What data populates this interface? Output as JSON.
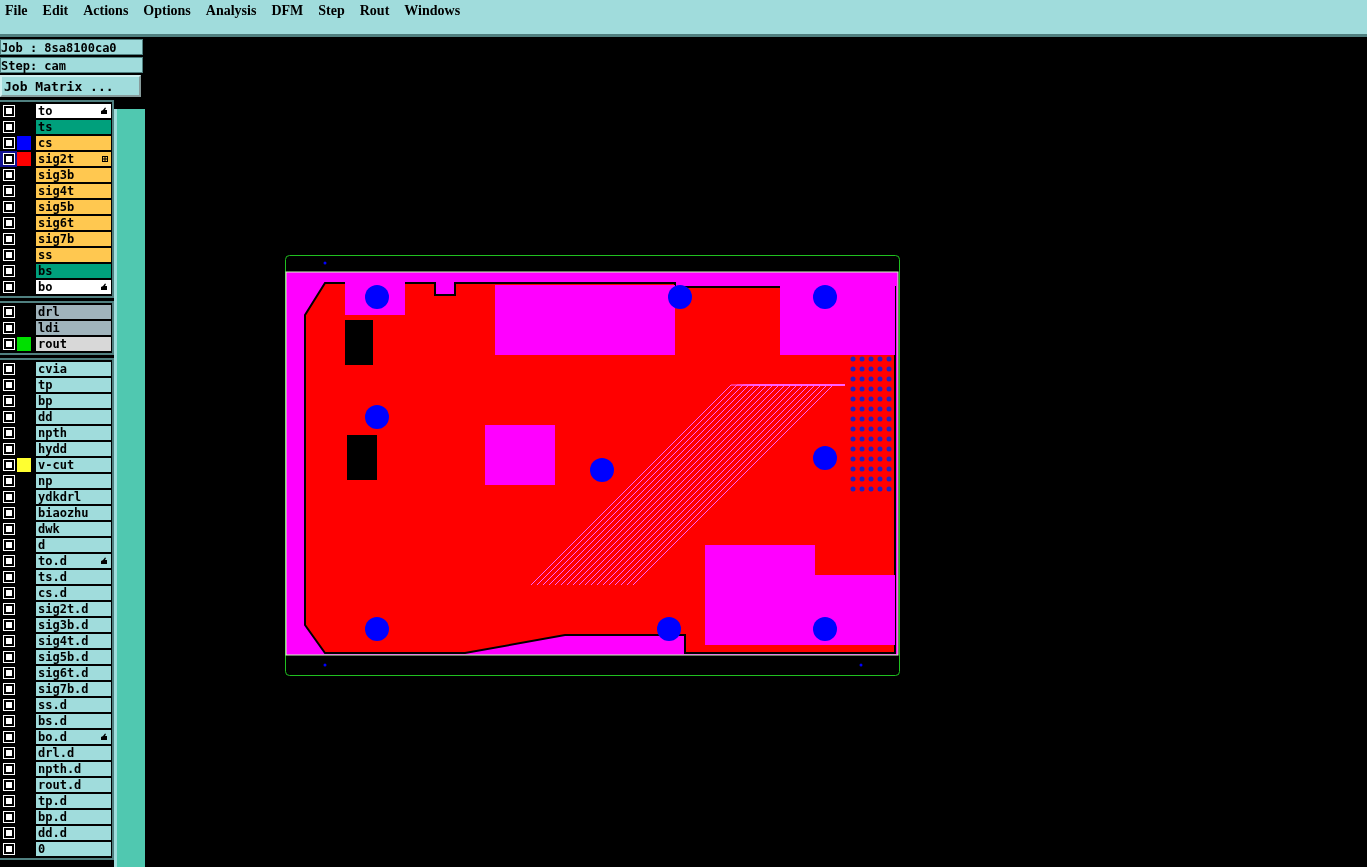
{
  "menu": [
    "File",
    "Edit",
    "Actions",
    "Options",
    "Analysis",
    "DFM",
    "Step",
    "Rout",
    "Windows"
  ],
  "job": {
    "job_line": "Job : 8sa8100ca0",
    "step_line": "Step: cam",
    "matrix_button": "Job Matrix ..."
  },
  "layer_groups": [
    [
      {
        "name": "to",
        "kind": "board",
        "selected": false,
        "affected": true,
        "attached": false
      },
      {
        "name": "ts",
        "kind": "solder",
        "selected": false,
        "affected": false,
        "attached": false
      },
      {
        "name": "cs",
        "kind": "signal",
        "selected": false,
        "affected": false,
        "attached": false,
        "color": "#0000ff"
      },
      {
        "name": "sig2t",
        "kind": "signal",
        "selected": true,
        "affected": false,
        "attached": true,
        "color": "#ff0000"
      },
      {
        "name": "sig3b",
        "kind": "signal",
        "selected": false,
        "affected": false,
        "attached": false
      },
      {
        "name": "sig4t",
        "kind": "signal",
        "selected": false,
        "affected": false,
        "attached": false
      },
      {
        "name": "sig5b",
        "kind": "signal",
        "selected": false,
        "affected": false,
        "attached": false
      },
      {
        "name": "sig6t",
        "kind": "signal",
        "selected": false,
        "affected": false,
        "attached": false
      },
      {
        "name": "sig7b",
        "kind": "signal",
        "selected": false,
        "affected": false,
        "attached": false
      },
      {
        "name": "ss",
        "kind": "signal",
        "selected": false,
        "affected": false,
        "attached": false
      },
      {
        "name": "bs",
        "kind": "solder",
        "selected": false,
        "affected": false,
        "attached": false
      },
      {
        "name": "bo",
        "kind": "board",
        "selected": false,
        "affected": true,
        "attached": false
      }
    ],
    [
      {
        "name": "drl",
        "kind": "drill",
        "selected": false,
        "affected": false,
        "attached": false
      },
      {
        "name": "ldi",
        "kind": "drill",
        "selected": false,
        "affected": false,
        "attached": false
      },
      {
        "name": "rout",
        "kind": "rout",
        "selected": false,
        "affected": false,
        "attached": false,
        "color": "#00e000"
      }
    ],
    [
      {
        "name": "cvia",
        "kind": "misc",
        "selected": false,
        "affected": false,
        "attached": false
      },
      {
        "name": "tp",
        "kind": "misc",
        "selected": false,
        "affected": false,
        "attached": false
      },
      {
        "name": "bp",
        "kind": "misc",
        "selected": false,
        "affected": false,
        "attached": false
      },
      {
        "name": "dd",
        "kind": "misc",
        "selected": false,
        "affected": false,
        "attached": false
      },
      {
        "name": "npth",
        "kind": "misc",
        "selected": false,
        "affected": false,
        "attached": false
      },
      {
        "name": "hydd",
        "kind": "misc",
        "selected": false,
        "affected": false,
        "attached": false
      },
      {
        "name": "v-cut",
        "kind": "misc",
        "selected": false,
        "affected": false,
        "attached": false,
        "color": "#ffff30"
      },
      {
        "name": "np",
        "kind": "misc",
        "selected": false,
        "affected": false,
        "attached": false
      },
      {
        "name": "ydkdrl",
        "kind": "misc",
        "selected": false,
        "affected": false,
        "attached": false
      },
      {
        "name": "biaozhu",
        "kind": "misc",
        "selected": false,
        "affected": false,
        "attached": false
      },
      {
        "name": "dwk",
        "kind": "misc",
        "selected": false,
        "affected": false,
        "attached": false
      },
      {
        "name": "d",
        "kind": "misc",
        "selected": false,
        "affected": false,
        "attached": false
      },
      {
        "name": "to.d",
        "kind": "misc",
        "selected": false,
        "affected": true,
        "attached": false
      },
      {
        "name": "ts.d",
        "kind": "misc",
        "selected": false,
        "affected": false,
        "attached": false
      },
      {
        "name": "cs.d",
        "kind": "misc",
        "selected": false,
        "affected": false,
        "attached": false
      },
      {
        "name": "sig2t.d",
        "kind": "misc",
        "selected": false,
        "affected": false,
        "attached": false
      },
      {
        "name": "sig3b.d",
        "kind": "misc",
        "selected": false,
        "affected": false,
        "attached": false
      },
      {
        "name": "sig4t.d",
        "kind": "misc",
        "selected": false,
        "affected": false,
        "attached": false
      },
      {
        "name": "sig5b.d",
        "kind": "misc",
        "selected": false,
        "affected": false,
        "attached": false
      },
      {
        "name": "sig6t.d",
        "kind": "misc",
        "selected": false,
        "affected": false,
        "attached": false
      },
      {
        "name": "sig7b.d",
        "kind": "misc",
        "selected": false,
        "affected": false,
        "attached": false
      },
      {
        "name": "ss.d",
        "kind": "misc",
        "selected": false,
        "affected": false,
        "attached": false
      },
      {
        "name": "bs.d",
        "kind": "misc",
        "selected": false,
        "affected": false,
        "attached": false
      },
      {
        "name": "bo.d",
        "kind": "misc",
        "selected": false,
        "affected": true,
        "attached": false
      },
      {
        "name": "drl.d",
        "kind": "misc",
        "selected": false,
        "affected": false,
        "attached": false
      },
      {
        "name": "npth.d",
        "kind": "misc",
        "selected": false,
        "affected": false,
        "attached": false
      },
      {
        "name": "rout.d",
        "kind": "misc",
        "selected": false,
        "affected": false,
        "attached": false
      },
      {
        "name": "tp.d",
        "kind": "misc",
        "selected": false,
        "affected": false,
        "attached": false
      },
      {
        "name": "bp.d",
        "kind": "misc",
        "selected": false,
        "affected": false,
        "attached": false
      },
      {
        "name": "dd.d",
        "kind": "misc",
        "selected": false,
        "affected": false,
        "attached": false
      },
      {
        "name": "0",
        "kind": "misc",
        "selected": false,
        "affected": false,
        "attached": false
      }
    ]
  ]
}
